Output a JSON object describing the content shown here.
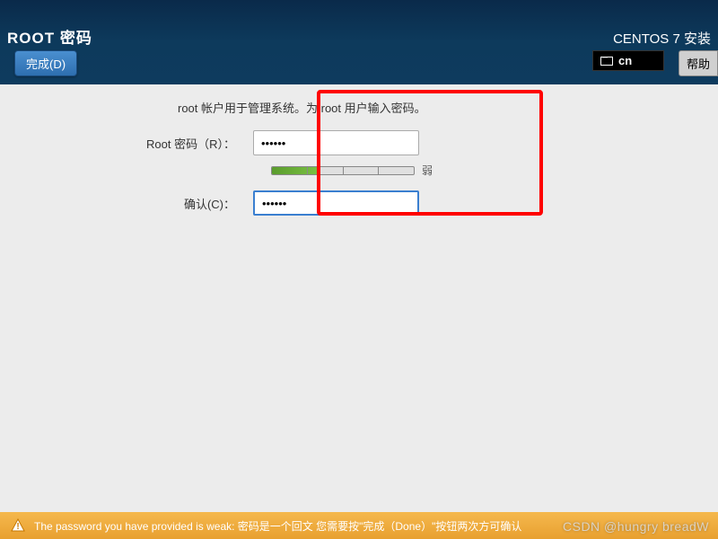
{
  "header": {
    "title_left": "ROOT 密码",
    "done_label": "完成(D)",
    "title_right": "CENTOS 7 安装",
    "lang_code": "cn",
    "help_label": "帮助"
  },
  "content": {
    "intro": "root 帐户用于管理系统。为 root 用户输入密码。",
    "root_pwd_label": "Root 密码（R）：",
    "root_pwd_value": "••••••",
    "confirm_label": "确认(C)：",
    "confirm_value": "••••••",
    "strength_label": "弱"
  },
  "footer": {
    "warning_text": "The password you have provided is weak: 密码是一个回文 您需要按\"完成（Done）\"按钮两次方可确认"
  },
  "watermark": "CSDN @hungry breadW"
}
